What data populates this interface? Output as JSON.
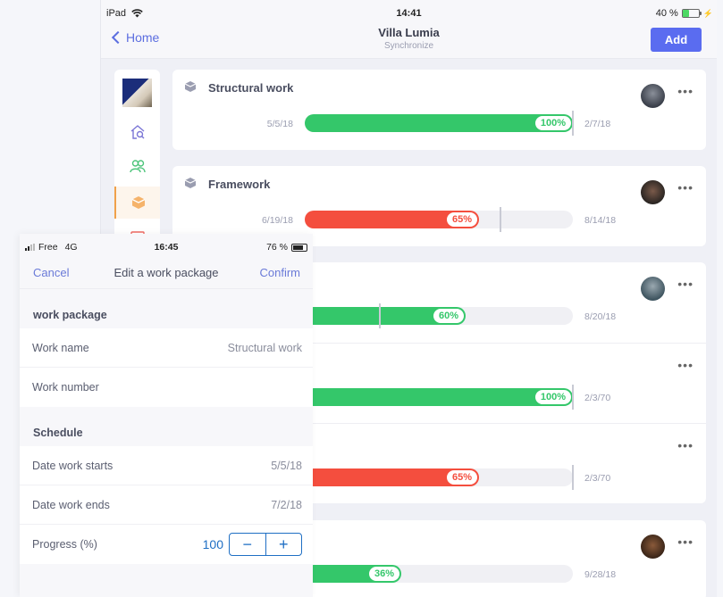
{
  "ipad": {
    "status": {
      "device": "iPad",
      "time": "14:41",
      "battery": "40 %",
      "battery_level": 0.4
    },
    "nav": {
      "back_label": "Home",
      "title": "Villa Lumia",
      "subtitle": "Synchronize",
      "add_label": "Add"
    },
    "sidebar": {
      "items": [
        {
          "icon": "house-search-icon",
          "color": "#7b76d6"
        },
        {
          "icon": "users-icon",
          "color": "#4cc47a"
        },
        {
          "icon": "package-icon",
          "color": "#f0a14a",
          "active": true
        },
        {
          "icon": "calendar-icon",
          "color": "#ef6a63"
        }
      ]
    },
    "work_packages": [
      {
        "title": "Structural work",
        "start": "5/5/18",
        "end": "2/7/18",
        "progress": 100,
        "progress_label": "100%",
        "status_color": "#34c76a",
        "planned_marker": 1.0,
        "has_avatar": true
      },
      {
        "title": "Framework",
        "start": "6/19/18",
        "end": "8/14/18",
        "progress": 65,
        "progress_label": "65%",
        "status_color": "#f44e3e",
        "planned_marker": 0.73,
        "has_avatar": true
      },
      {
        "title": "",
        "start": "",
        "end": "8/20/18",
        "progress": 60,
        "progress_label": "60%",
        "status_color": "#34c76a",
        "planned_marker": 0.28,
        "has_avatar": true
      },
      {
        "title": "",
        "start": "",
        "end": "2/3/70",
        "progress": 100,
        "progress_label": "100%",
        "status_color": "#34c76a",
        "planned_marker": 1.0,
        "has_avatar": false
      },
      {
        "title": "",
        "start": "",
        "end": "2/3/70",
        "progress": 65,
        "progress_label": "65%",
        "status_color": "#f44e3e",
        "planned_marker": 1.0,
        "has_avatar": false
      },
      {
        "title": "",
        "start": "",
        "end": "9/28/18",
        "progress": 36,
        "progress_label": "36%",
        "status_color": "#34c76a",
        "planned_marker": null,
        "has_avatar": true
      }
    ]
  },
  "phone": {
    "status": {
      "carrier": "Free",
      "network": "4G",
      "time": "16:45",
      "battery": "76 %",
      "battery_level": 0.76
    },
    "nav": {
      "cancel_label": "Cancel",
      "title": "Edit a work package",
      "confirm_label": "Confirm"
    },
    "sections": {
      "work_package": {
        "heading": "work package",
        "work_name_label": "Work name",
        "work_name_value": "Structural work",
        "work_number_label": "Work number",
        "work_number_value": ""
      },
      "schedule": {
        "heading": "Schedule",
        "start_label": "Date work starts",
        "start_value": "5/5/18",
        "end_label": "Date work ends",
        "end_value": "7/2/18",
        "progress_label": "Progress (%)",
        "progress_value": "100",
        "minus": "−",
        "plus": "+"
      }
    }
  }
}
